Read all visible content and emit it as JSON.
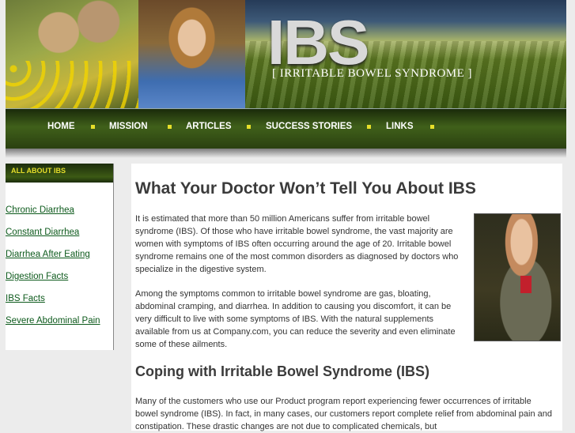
{
  "header": {
    "title": "IBS",
    "subtitle": "[ IRRITABLE BOWEL SYNDROME ]"
  },
  "nav": {
    "items": [
      {
        "label": "HOME"
      },
      {
        "label": "MISSION"
      },
      {
        "label": "ARTICLES"
      },
      {
        "label": "SUCCESS STORIES"
      },
      {
        "label": "LINKS"
      }
    ],
    "separator_color": "#e6df2a"
  },
  "sidebar": {
    "heading": "ALL ABOUT IBS",
    "links": [
      {
        "label": "Chronic Diarrhea"
      },
      {
        "label": "Constant Diarrhea"
      },
      {
        "label": "Diarrhea After Eating"
      },
      {
        "label": "Digestion Facts"
      },
      {
        "label": "IBS Facts"
      },
      {
        "label": "Severe Abdominal Pain"
      }
    ]
  },
  "article": {
    "title": "What Your Doctor Won’t Tell You About IBS",
    "paragraphs": [
      "It is estimated that more than 50 million Americans suffer from irritable bowel syndrome (IBS). Of those who have irritable bowel syndrome, the vast majority are women with symptoms of IBS often occurring around the age of 20. Irritable bowel syndrome remains one of the most common disorders as diagnosed by doctors who specialize in the digestive system.",
      "Among the symptoms common to irritable bowel syndrome are gas, bloating, abdominal cramping, and diarrhea. In addition to causing you discomfort, it can be very difficult to live with some symptoms of IBS. With the natural supplements available from us at Company.com, you can reduce the severity and even eliminate some of these ailments."
    ],
    "subheading": "Coping with Irritable Bowel Syndrome (IBS)",
    "paragraph3": "Many of the customers who use our Product program report experiencing fewer occurrences of irritable bowel syndrome (IBS). In fact, in many cases, our customers report complete relief from abdominal pain and constipation. These drastic changes are not due to complicated chemicals, but"
  }
}
